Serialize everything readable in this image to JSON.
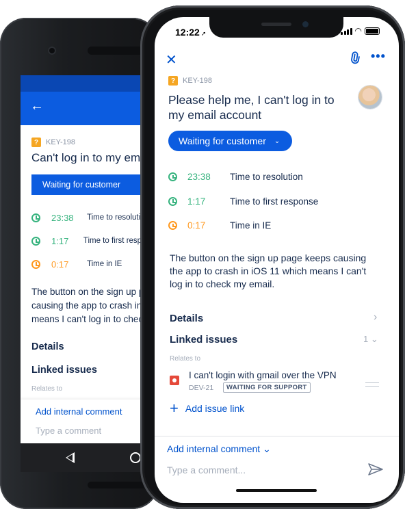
{
  "android": {
    "issue_key": "KEY-198",
    "issue_type_badge": "?",
    "title": "Can't log in to my email account",
    "status": "Waiting for customer",
    "sla": [
      {
        "time": "23:38",
        "label": "Time to resolution",
        "color": "#36b37e"
      },
      {
        "time": "1:17",
        "label": "Time to first response",
        "color": "#36b37e"
      },
      {
        "time": "0:17",
        "label": "Time in IE",
        "color": "#ff991f"
      }
    ],
    "description": [
      "The button on the sign up page keeps",
      "causing the app to crash in iOS 11 which",
      "means I can't log in to check my email."
    ],
    "details_label": "Details",
    "linked_issues_label": "Linked issues",
    "relates_to_label": "Relates to",
    "add_internal_comment": "Add internal comment",
    "comment_placeholder": "Type a comment",
    "back_icon": "←"
  },
  "iphone": {
    "status_bar": {
      "time": "12:22",
      "location_icon": "➚"
    },
    "close_icon": "✕",
    "attach_icon": "📎",
    "more_icon": "•••",
    "issue_key": "KEY-198",
    "issue_type_badge": "?",
    "title": "Please help me, I can't log in to my email account",
    "status": "Waiting for customer",
    "status_chevron": "⌄",
    "sla": [
      {
        "time": "23:38",
        "label": "Time to resolution",
        "color": "#36b37e"
      },
      {
        "time": "1:17",
        "label": "Time to first response",
        "color": "#36b37e"
      },
      {
        "time": "0:17",
        "label": "Time in IE",
        "color": "#ff991f"
      }
    ],
    "description": "The button on the sign up page keeps causing the app to crash in iOS 11 which means I can't log in to check my email.",
    "details_label": "Details",
    "details_chevron": "›",
    "linked_issues_label": "Linked issues",
    "linked_issues_count": "1 ⌄",
    "relates_to_label": "Relates to",
    "linked_issue": {
      "title": "I can't login with gmail over the VPN",
      "key": "DEV-21",
      "status": "WAITING FOR SUPPORT"
    },
    "add_issue_link": "Add issue link",
    "add_internal_comment": "Add internal comment ⌄",
    "comment_placeholder": "Type a comment..."
  },
  "colors": {
    "primary": "#0c5ce0",
    "link": "#0052cc",
    "text": "#172b4d",
    "muted": "#a5adba",
    "sla_green": "#36b37e",
    "sla_orange": "#ff991f",
    "issue_bug": "#e5493a",
    "question_badge": "#f5a623"
  }
}
